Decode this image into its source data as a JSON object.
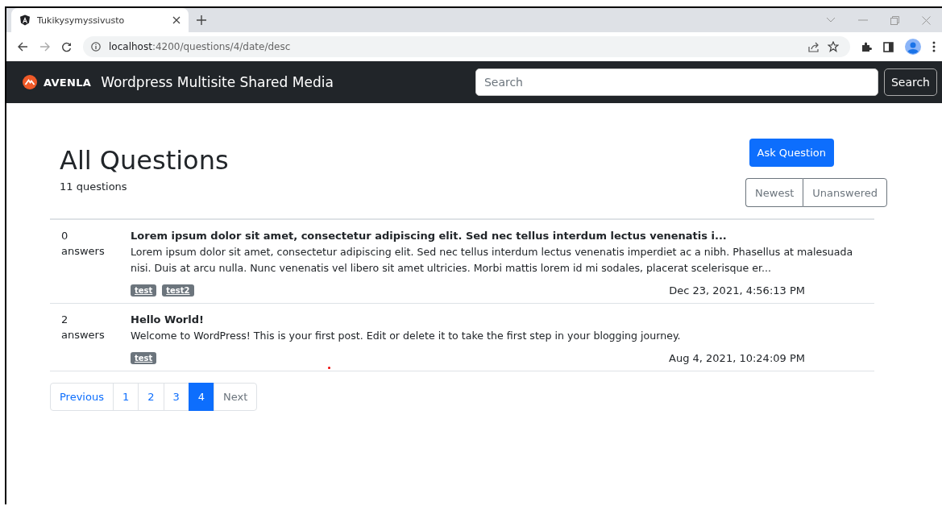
{
  "browser": {
    "tab_title": "Tukikysymyssivusto",
    "address": {
      "host": "localhost",
      "path": ":4200/questions/4/date/desc"
    }
  },
  "navbar": {
    "brand": "AVENLA",
    "title": "Wordpress Multisite Shared Media",
    "search": {
      "placeholder": "Search"
    },
    "search_button": "Search"
  },
  "page": {
    "heading": "All Questions",
    "count": "11 questions",
    "ask_button": "Ask Question",
    "sort_buttons": [
      "Newest",
      "Unanswered"
    ]
  },
  "questions": [
    {
      "answers": "0",
      "answers_label": "answers",
      "title": "Lorem ipsum dolor sit amet, consectetur adipiscing elit. Sed nec tellus interdum lectus venenatis i...",
      "excerpt": "Lorem ipsum dolor sit amet, consectetur adipiscing elit. Sed nec tellus interdum lectus venenatis imperdiet ac a nibh. Phasellus at malesuada nisi. Duis at arcu nulla. Nunc venenatis vel libero sit amet ultricies. Morbi mattis lorem id mi sodales, placerat scelerisque er...",
      "tags": [
        "test",
        "test2"
      ],
      "date": "Dec 23, 2021, 4:56:13 PM"
    },
    {
      "answers": "2",
      "answers_label": "answers",
      "title": "Hello World!",
      "excerpt": "Welcome to WordPress! This is your first post. Edit or delete it to take the first step in your blogging journey.",
      "tags": [
        "test"
      ],
      "date": "Aug 4, 2021, 10:24:09 PM"
    }
  ],
  "pagination": [
    {
      "label": "Previous",
      "kind": "nav",
      "selected": false
    },
    {
      "label": "1",
      "kind": "page",
      "selected": false
    },
    {
      "label": "2",
      "kind": "page",
      "selected": false
    },
    {
      "label": "3",
      "kind": "page",
      "selected": false
    },
    {
      "label": "4",
      "kind": "page",
      "selected": true
    },
    {
      "label": "Next",
      "kind": "nav",
      "selected": false
    }
  ]
}
